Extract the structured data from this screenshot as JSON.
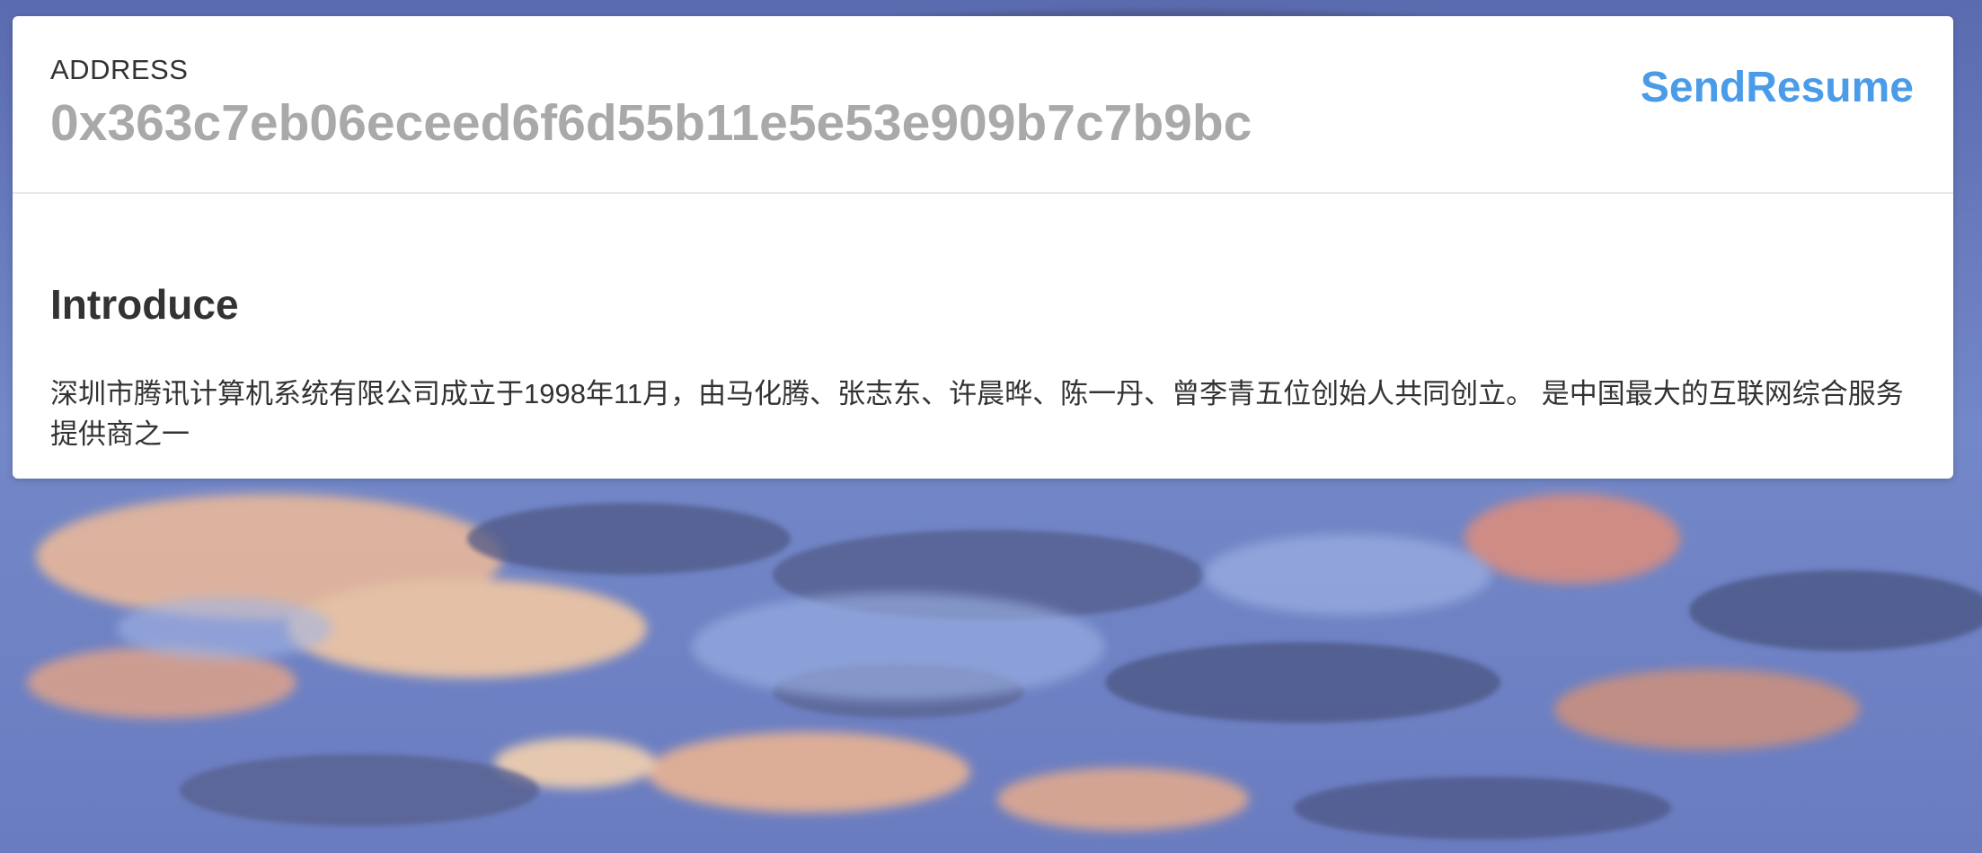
{
  "header": {
    "address_label": "ADDRESS",
    "address_value": "0x363c7eb06eceed6f6d55b11e5e53e909b7c7b9bc",
    "send_resume_label": "SendResume"
  },
  "intro": {
    "title": "Introduce",
    "text": "深圳市腾讯计算机系统有限公司成立于1998年11月，由马化腾、张志东、许晨晔、陈一丹、曾李青五位创始人共同创立。 是中国最大的互联网综合服务提供商之一"
  },
  "colors": {
    "accent": "#4a9be8",
    "address_value": "#a9a9a9",
    "text": "#333333",
    "card": "#ffffff"
  }
}
